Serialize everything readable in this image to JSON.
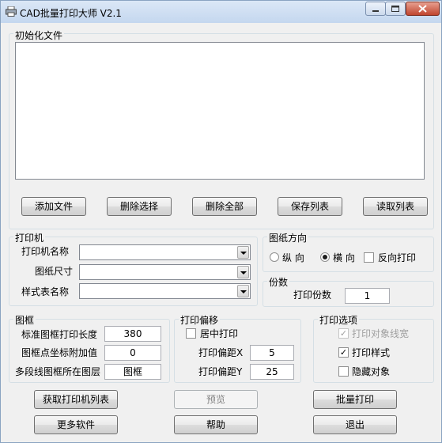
{
  "window": {
    "title": "CAD批量打印大师 V2.1"
  },
  "init_files": {
    "legend": "初始化文件",
    "items": []
  },
  "file_buttons": {
    "add": "添加文件",
    "delete_selected": "删除选择",
    "delete_all": "删除全部",
    "save_list": "保存列表",
    "load_list": "读取列表"
  },
  "printer": {
    "legend": "打印机",
    "name_label": "打印机名称",
    "name_value": "",
    "paper_label": "图纸尺寸",
    "paper_value": "",
    "style_label": "样式表名称",
    "style_value": ""
  },
  "orientation": {
    "legend": "图纸方向",
    "portrait": "纵 向",
    "landscape": "横 向",
    "reverse": "反向打印",
    "selected": "landscape",
    "reverse_checked": false
  },
  "copies": {
    "legend": "份数",
    "label": "打印份数",
    "value": "1"
  },
  "frame": {
    "legend": "图框",
    "length_label": "标准图框打印长度",
    "length_value": "380",
    "offset_label": "图框点坐标附加值",
    "offset_value": "0",
    "layer_label": "多段线图框所在图层",
    "layer_value": "图框"
  },
  "offset": {
    "legend": "打印偏移",
    "center_label": "居中打印",
    "center_checked": false,
    "x_label": "打印偏距X",
    "x_value": "5",
    "y_label": "打印偏距Y",
    "y_value": "25"
  },
  "options": {
    "legend": "打印选项",
    "lineweight_label": "打印对象线宽",
    "lineweight_checked": true,
    "lineweight_enabled": false,
    "style_label": "打印样式",
    "style_checked": true,
    "hide_label": "隐藏对象",
    "hide_checked": false
  },
  "bottom_buttons": {
    "get_printers": "获取打印机列表",
    "preview": "预览",
    "batch_print": "批量打印",
    "more_software": "更多软件",
    "help": "帮助",
    "exit": "退出"
  },
  "colors": {
    "titlebar": "#c4d7ef",
    "window_bg": "#f0f0f0",
    "group_border": "#d5dfe5"
  }
}
